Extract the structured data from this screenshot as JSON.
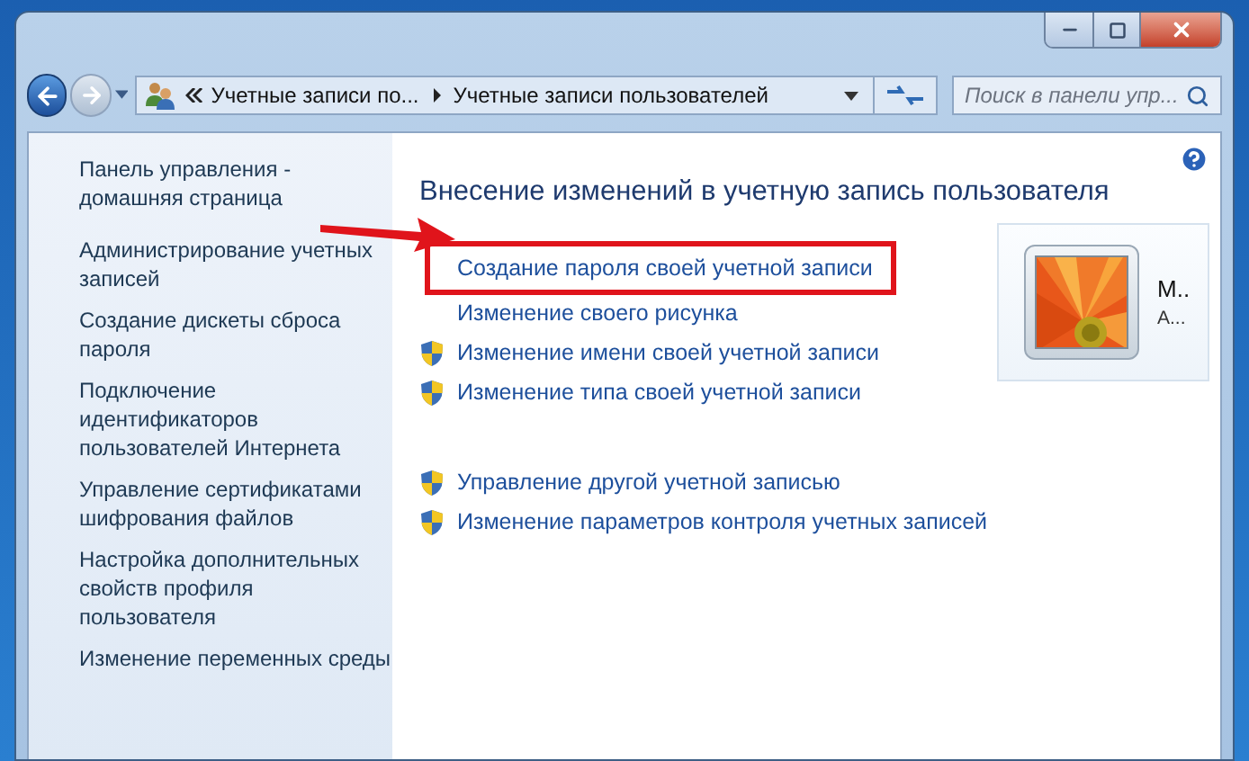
{
  "address_bar": {
    "segments": [
      "Учетные записи по...",
      "Учетные записи пользователей"
    ]
  },
  "search": {
    "placeholder": "Поиск в панели упр..."
  },
  "sidebar": {
    "items": [
      {
        "label": "Панель управления - домашняя страница"
      },
      {
        "label": "Администрирование учетных записей"
      },
      {
        "label": "Создание дискеты сброса пароля"
      },
      {
        "label": "Подключение идентификаторов пользователей Интернета"
      },
      {
        "label": "Управление сертификатами шифрования файлов"
      },
      {
        "label": "Настройка дополнительных свойств профиля пользователя"
      },
      {
        "label": "Изменение переменных среды"
      }
    ]
  },
  "main": {
    "title": "Внесение изменений в учетную запись пользователя",
    "task_groups": [
      [
        {
          "label": "Создание пароля своей учетной записи",
          "shield": false,
          "highlighted": true
        },
        {
          "label": "Изменение своего рисунка",
          "shield": false,
          "highlighted": false
        },
        {
          "label": "Изменение имени своей учетной записи",
          "shield": true,
          "highlighted": false
        },
        {
          "label": "Изменение типа своей учетной записи",
          "shield": true,
          "highlighted": false
        }
      ],
      [
        {
          "label": "Управление другой учетной записью",
          "shield": true,
          "highlighted": false
        },
        {
          "label": "Изменение параметров контроля учетных записей",
          "shield": true,
          "highlighted": false
        }
      ]
    ],
    "account": {
      "name": "М..",
      "type": "А..."
    }
  }
}
